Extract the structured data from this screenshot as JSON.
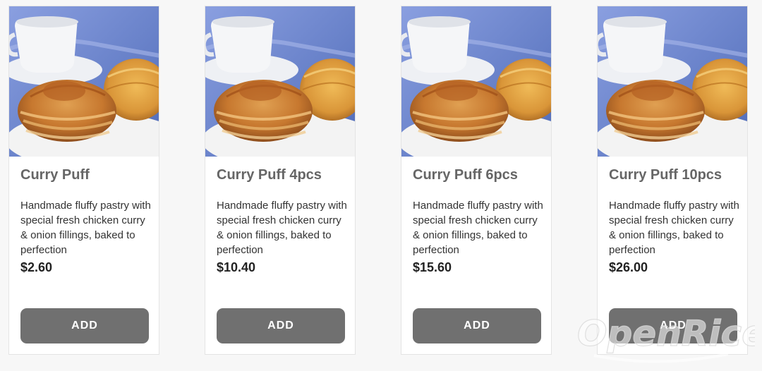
{
  "products": [
    {
      "name": "Curry Puff",
      "description": "Handmade fluffy pastry with special fresh chicken curry & onion fillings, baked to perfection",
      "price": "$2.60",
      "button_label": "ADD"
    },
    {
      "name": "Curry Puff 4pcs",
      "description": "Handmade fluffy pastry with special fresh chicken curry & onion fillings, baked to perfection",
      "price": "$10.40",
      "button_label": "ADD"
    },
    {
      "name": "Curry Puff 6pcs",
      "description": "Handmade fluffy pastry with special fresh chicken curry & onion fillings, baked to perfection",
      "price": "$15.60",
      "button_label": "ADD"
    },
    {
      "name": "Curry Puff 10pcs",
      "description": "Handmade fluffy pastry with special fresh chicken curry & onion fillings, baked to perfection",
      "price": "$26.00",
      "button_label": "ADD"
    }
  ],
  "watermark": {
    "text": "OpenRice"
  },
  "colors": {
    "button_bg": "#707070",
    "button_text": "#ffffff",
    "title_text": "#666666",
    "price_text": "#222222"
  }
}
